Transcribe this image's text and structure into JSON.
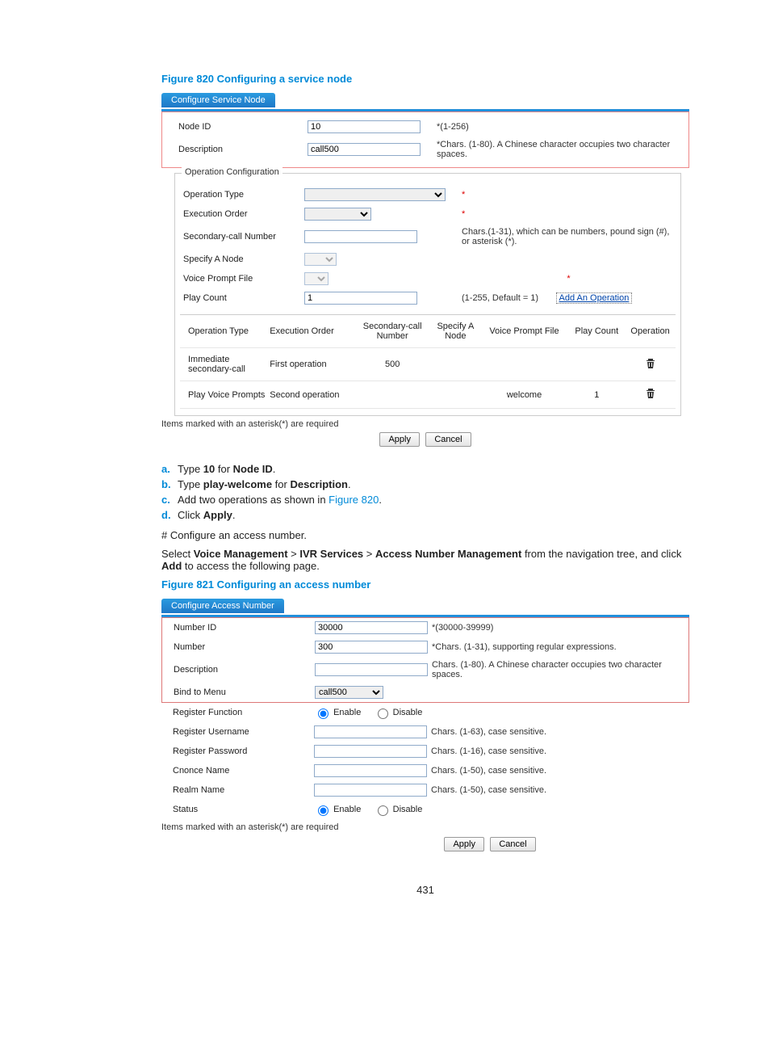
{
  "page_number": "431",
  "figure820": {
    "title": "Figure 820 Configuring a service node",
    "tab": "Configure Service Node",
    "node_id_label": "Node ID",
    "node_id_value": "10",
    "node_id_help": "*(1-256)",
    "desc_label": "Description",
    "desc_value": "call500",
    "desc_help": "*Chars. (1-80). A Chinese character occupies two character spaces.",
    "opcfg_legend": "Operation Configuration",
    "op_type_label": "Operation Type",
    "op_type_req": "*",
    "exec_order_label": "Execution Order",
    "exec_order_req": "*",
    "sec_call_label": "Secondary-call Number",
    "sec_call_help": "Chars.(1-31), which can be numbers, pound sign (#), or asterisk (*).",
    "specify_node_label": "Specify A Node",
    "voice_prompt_label": "Voice Prompt File",
    "voice_prompt_req": "*",
    "play_count_label": "Play Count",
    "play_count_value": "1",
    "play_count_help": "(1-255, Default = 1)",
    "add_op_btn": "Add An Operation",
    "table": {
      "h1": "Operation Type",
      "h2": "Execution Order",
      "h3": "Secondary-call Number",
      "h4": "Specify A Node",
      "h5": "Voice Prompt File",
      "h6": "Play Count",
      "h7": "Operation",
      "r1": {
        "type": "Immediate secondary-call",
        "order": "First operation",
        "sec": "500",
        "node": "",
        "vp": "",
        "pc": ""
      },
      "r2": {
        "type": "Play Voice Prompts",
        "order": "Second operation",
        "sec": "",
        "node": "",
        "vp": "welcome",
        "pc": "1"
      }
    },
    "footnote": "Items marked with an asterisk(*) are required",
    "apply": "Apply",
    "cancel": "Cancel"
  },
  "steps": {
    "a_pre": "Type ",
    "a_b1": "10",
    "a_mid": " for ",
    "a_b2": "Node ID",
    "a_post": ".",
    "b_pre": "Type ",
    "b_b1": "play-welcome",
    "b_mid": " for ",
    "b_b2": "Description",
    "b_post": ".",
    "c_pre": "Add two operations as shown in ",
    "c_link": "Figure 820",
    "c_post": ".",
    "d_pre": "Click ",
    "d_b1": "Apply",
    "d_post": "."
  },
  "instr": {
    "hash_line": "# Configure an access number.",
    "select_pre": "Select ",
    "vm": "Voice Management",
    "gt": " > ",
    "ivr": "IVR Services",
    "anm": "Access Number Management",
    "select_post": " from the navigation tree, and click ",
    "add_b": "Add",
    "select_end": " to access the following page."
  },
  "figure821": {
    "title": "Figure 821 Configuring an access number",
    "tab": "Configure Access Number",
    "number_id_label": "Number ID",
    "number_id_value": "30000",
    "number_id_help": "*(30000-39999)",
    "number_label": "Number",
    "number_value": "300",
    "number_help": "*Chars. (1-31), supporting regular expressions.",
    "desc_label": "Description",
    "desc_help": "Chars. (1-80). A Chinese character occupies two character spaces.",
    "bind_label": "Bind to Menu",
    "bind_value": "call500",
    "regfn_label": "Register Function",
    "enable": "Enable",
    "disable": "Disable",
    "reguser_label": "Register Username",
    "reguser_help": "Chars. (1-63), case sensitive.",
    "regpw_label": "Register Password",
    "regpw_help": "Chars. (1-16), case sensitive.",
    "cnonce_label": "Cnonce Name",
    "cnonce_help": "Chars. (1-50), case sensitive.",
    "realm_label": "Realm Name",
    "realm_help": "Chars. (1-50), case sensitive.",
    "status_label": "Status",
    "footnote": "Items marked with an asterisk(*) are required",
    "apply": "Apply",
    "cancel": "Cancel"
  }
}
